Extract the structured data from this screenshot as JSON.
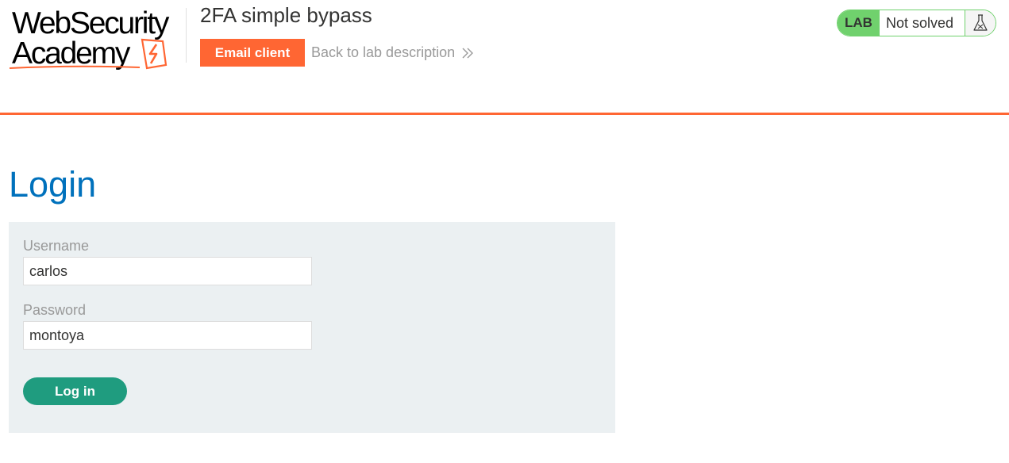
{
  "header": {
    "logo": {
      "line1": "WebSecurity",
      "line2": "Academy"
    },
    "lab_title": "2FA simple bypass",
    "email_client_label": "Email client",
    "back_link_label": "Back to lab description",
    "status": {
      "badge": "LAB",
      "text": "Not solved",
      "icon": "flask-icon"
    }
  },
  "main": {
    "heading": "Login",
    "form": {
      "username_label": "Username",
      "username_value": "carlos",
      "password_label": "Password",
      "password_value": "montoya",
      "submit_label": "Log in"
    }
  },
  "colors": {
    "accent_orange": "#ff6633",
    "heading_blue": "#0071bc",
    "lab_green": "#70d16d",
    "button_teal": "#1f9c7f",
    "panel_bg": "#ebf0f2"
  }
}
